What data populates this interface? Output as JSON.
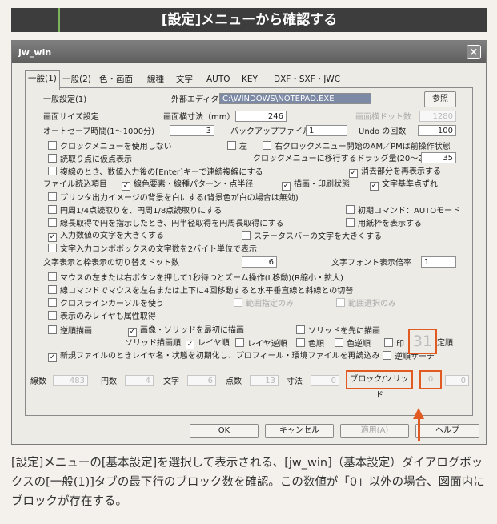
{
  "banner": {
    "title": "[設定]メニューから確認する"
  },
  "window": {
    "title": "jw_win",
    "close": "×"
  },
  "tabs": [
    "一般(1)",
    "一般(2)",
    "色・画面",
    "線種",
    "文字",
    "AUTO",
    "KEY",
    "DXF・SXF・JWC"
  ],
  "settings": {
    "ippan_label": "一般設定(1)",
    "editor_label": "外部エディタ",
    "editor_path": "C:\\WINDOWS\\NOTEPAD.EXE",
    "browse_button": "参照",
    "screen_size_label": "画面サイズ設定",
    "screen_width_label": "画面横寸法（mm）",
    "screen_width_value": "246",
    "screen_dots_label": "画面横ドット数",
    "screen_dots_value": "1280",
    "autosave_label": "オートセーブ時間(1〜1000分)",
    "autosave_value": "3",
    "backup_label": "バックアップファイル数",
    "backup_value": "1",
    "undo_label": "Undo の回数",
    "undo_value": "100",
    "drag_label": "クロックメニューに移行するドラッグ量(20〜200)",
    "drag_value": "35",
    "linetype_width_label": "文字表示と枠表示の切り替えドット数",
    "linetype_width_value": "6",
    "font_scale_label": "文字フォント表示倍率",
    "font_scale_value": "1",
    "file_read_label": "ファイル読込項目"
  },
  "checkboxes": {
    "clock_menu": "クロックメニューを使用しない",
    "left": "左",
    "right_clock": "右クロックメニュー開始のAM／PMは前操作状態",
    "read_point": "読取り点に仮点表示",
    "enter_key": "複線のとき、数値入力後の[Enter]キーで連続複線にする",
    "erase_redraw": "消去部分を再表示する",
    "color_line": "線色要素・線種パターン・点半径",
    "draw_print": "描画・印刷状態",
    "text_base": "文字基準点ずれ",
    "printer_bg": "プリンタ出力イメージの背景を白にする(背景色が白の場合は無効)",
    "circle_quarter": "円周1/4点読取りを、円周1/8点読取りにする",
    "initial_cmd": "初期コマンド：AUTOモード",
    "line_circle": "線長取得で円を指示したとき、円半径取得を円周長取得にする",
    "paper_frame": "用紙枠を表示する",
    "input_large": "入力数値の文字を大きくする",
    "status_large": "ステータスバーの文字を大きくする",
    "text_combobox": "文字入力コンボボックスの文字数を2バイト単位で表示",
    "mouse_zoom": "マウスの左または右ボタンを押して1秒待つとズーム操作(L移動)(R縮小・拡大)",
    "line_cmd": "線コマンドでマウスを左右または上下に4回移動すると水平垂直線と斜線との切替",
    "crossline": "クロスラインカーソルを使う",
    "cross_full": "範囲指定のみ",
    "cross_area": "範囲選択のみ",
    "show_layer": "表示のみレイヤも属性取得",
    "reverse_draw": "逆順描画",
    "image_solid_first": "画像・ソリッドを最初に描画",
    "solid_before": "ソリッドを先に描画",
    "solid_order_label": "ソリッド描画順",
    "layer_order": "レイヤ順",
    "layer_reverse": "レイヤ逆順",
    "color_order": "色順",
    "color_reverse": "色逆順",
    "print_prefix": "印",
    "spec_order": "定順",
    "reverse_search": "逆順サーチ",
    "new_file_init": "新規ファイルのときレイヤ名・状態を初期化し、プロフィール・環境ファイルを再読込み"
  },
  "stats": {
    "lines_label": "線数",
    "lines_value": "483",
    "circles_label": "円数",
    "circles_value": "4",
    "texts_label": "文字",
    "texts_value": "6",
    "points_label": "点数",
    "points_value": "13",
    "dims_label": "寸法",
    "dims_value": "0",
    "block_solid_label": "ブロック/ソリッド",
    "block_value": "0",
    "solid_value": "0",
    "callout_value": "31"
  },
  "buttons": {
    "ok": "OK",
    "cancel": "キャンセル",
    "apply": "適用(A)",
    "help": "ヘルプ"
  },
  "caption": "[設定]メニューの[基本設定]を選択して表示される、[jw_win]（基本設定）ダイアログボックスの[一般(1)]タブの最下行のブロック数を確認。この数値が「0」以外の場合、図面内にブロックが存在する。",
  "colors": {
    "banner": "#3d3d3d",
    "accent": "#7fb55a",
    "highlight": "#e05a22"
  }
}
